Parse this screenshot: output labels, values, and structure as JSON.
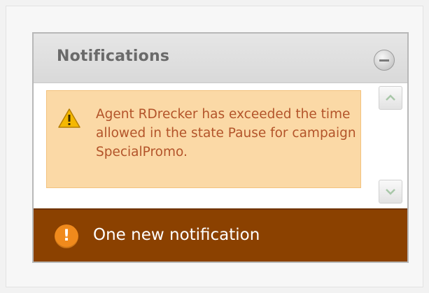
{
  "notifications_panel": {
    "title": "Notifications",
    "collapse_icon": "minus-circle-icon",
    "alert": {
      "icon": "warning-triangle-icon",
      "message": "Agent RDrecker has exceeded the time allowed in the state Pause for campaign SpecialPromo."
    },
    "scroll": {
      "up_icon": "chevron-up-icon",
      "down_icon": "chevron-down-icon"
    }
  },
  "toast": {
    "icon": "exclamation-circle-icon",
    "text": "One new notification"
  },
  "colors": {
    "alert_background": "#fbd9a6",
    "alert_text": "#b3542a",
    "toast_background": "#8b4100",
    "toast_icon": "#f08a1c"
  }
}
